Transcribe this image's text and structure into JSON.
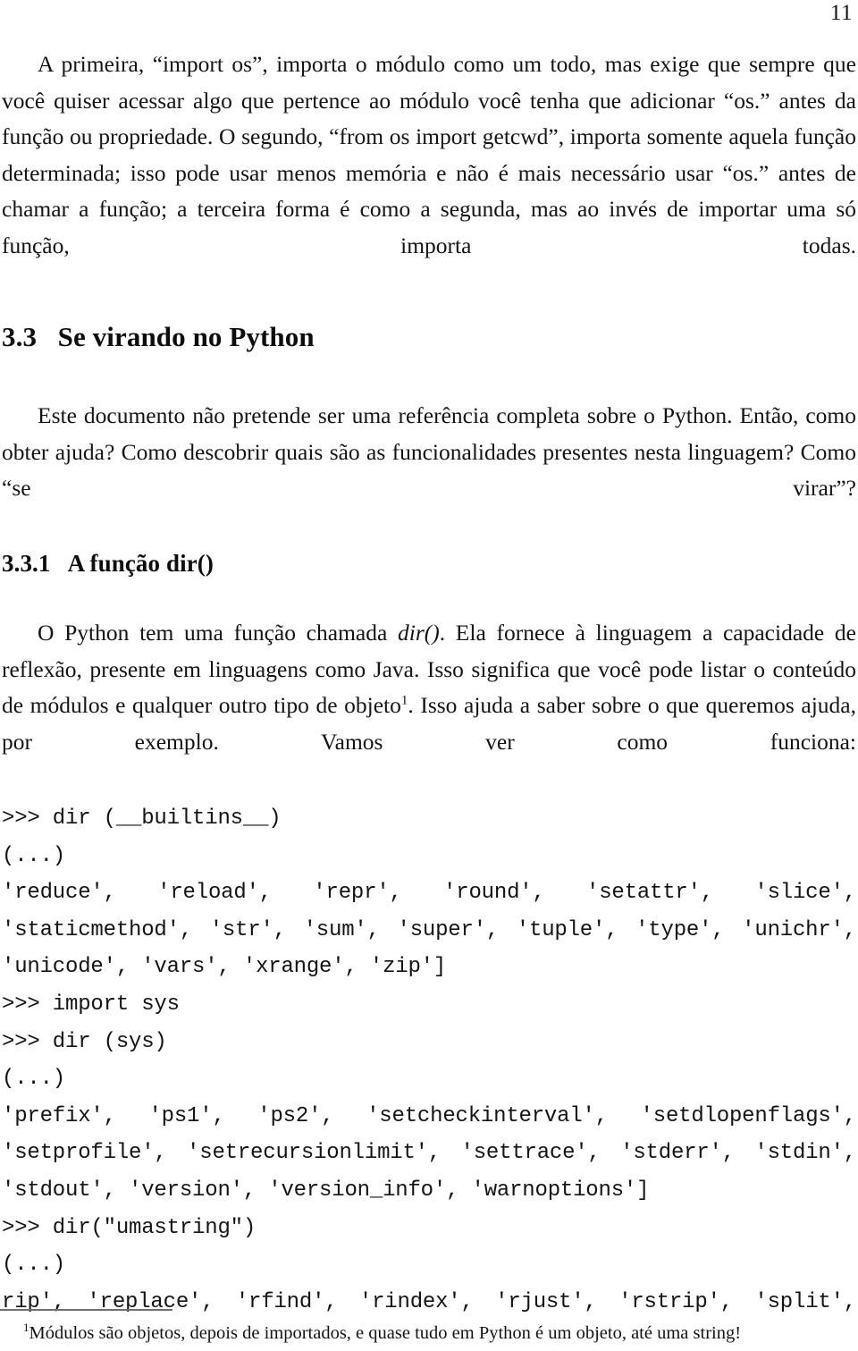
{
  "page": {
    "folio": "11",
    "language": "pt-BR",
    "paper_color": "#ffffff",
    "text_color": "#141414",
    "rule_color": "#6f6f6f"
  },
  "paragraphs": {
    "p1": "A primeira, “import os”, importa o módulo como um todo, mas exige que sempre que você quiser acessar algo que pertence ao módulo você tenha que adicionar “os.” antes da função ou propriedade. O segundo, “from os import getcwd”, importa somente aquela função determinada; isso pode usar menos memória e não é mais necessário usar “os.” antes de chamar a função; a terceira forma é como a segunda, mas ao invés de importar uma só função, importa todas.",
    "p2": "Este documento não pretende ser uma referência completa sobre o Python. Então, como obter ajuda? Como descobrir quais são as funcionalidades presentes nesta linguagem? Como “se virar”?",
    "p3_part1": "O Python tem uma função chamada ",
    "p3_italic": "dir()",
    "p3_part2": ". Ela fornece à linguagem a capacidade de reflexão, presente em linguagens como Java. Isso significa que você pode listar o conteúdo de módulos e qualquer outro tipo de objeto",
    "p3_footnote_marker": "1",
    "p3_part3": ". Isso ajuda a saber sobre o que queremos ajuda, por exemplo. Vamos ver como funciona:"
  },
  "headings": {
    "section": {
      "number": "3.3",
      "title": "Se virando no Python"
    },
    "subsection": {
      "number": "3.3.1",
      "title": "A função dir()"
    }
  },
  "code_block": {
    "lines": [
      {
        "text": ">>> dir (__builtins__)",
        "justified": false
      },
      {
        "text": "(...)",
        "justified": false
      },
      {
        "text": "'reduce', 'reload', 'repr', 'round', 'setattr', 'slice',",
        "justified": true
      },
      {
        "text": "'staticmethod', 'str', 'sum', 'super', 'tuple', 'type', 'unichr',",
        "justified": true
      },
      {
        "text": "'unicode', 'vars', 'xrange', 'zip']",
        "justified": false
      },
      {
        "text": ">>> import sys",
        "justified": false
      },
      {
        "text": ">>> dir (sys)",
        "justified": false
      },
      {
        "text": "(...)",
        "justified": false
      },
      {
        "text": "'prefix', 'ps1', 'ps2', 'setcheckinterval', 'setdlopenflags',",
        "justified": true
      },
      {
        "text": "'setprofile', 'setrecursionlimit', 'settrace', 'stderr', 'stdin',",
        "justified": true
      },
      {
        "text": "'stdout', 'version', 'version_info', 'warnoptions']",
        "justified": false
      },
      {
        "text": ">>> dir(\"umastring\")",
        "justified": false
      },
      {
        "text": "(...)",
        "justified": false
      },
      {
        "text": "rip', 'replace', 'rfind', 'rindex', 'rjust', 'rstrip', 'split',",
        "justified": true
      }
    ]
  },
  "footnote": {
    "marker": "1",
    "text": "Módulos são objetos, depois de importados, e quase tudo em Python é um objeto, até uma string!"
  }
}
